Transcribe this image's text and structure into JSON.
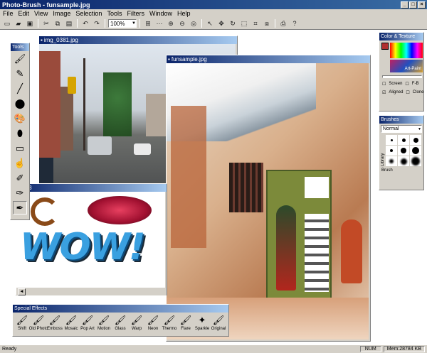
{
  "app": {
    "title": "Photo-Brush - funsample.jpg"
  },
  "menu": [
    "File",
    "Edit",
    "View",
    "Image",
    "Selection",
    "Tools",
    "Filters",
    "Window",
    "Help"
  ],
  "toolbar": {
    "zoom": "100%"
  },
  "windows": {
    "street": {
      "title": "img_0381.jpg"
    },
    "main": {
      "title": "funsample.jpg"
    },
    "wow": {
      "title": "wo8",
      "text": "WOW!"
    }
  },
  "tools_panel": {
    "title": "Tools"
  },
  "color_texture": {
    "title": "Color & Texture",
    "texture_name": "Art-Paint",
    "checks": [
      "Screen",
      "F-B",
      "Aligned",
      "Clone"
    ]
  },
  "brushes": {
    "title": "Brushes",
    "mode": "Normal",
    "side_label": "Library",
    "footer": "Brush"
  },
  "effects": {
    "title": "Special Effects",
    "items": [
      "Shift",
      "Old Photo",
      "Emboss",
      "Mosaic",
      "Pop Art",
      "Motion",
      "Glass",
      "Warp",
      "Neon",
      "Thermo",
      "Flare",
      "Sparkle",
      "Original"
    ]
  },
  "statusbar": {
    "left": "Ready",
    "num": "NUM",
    "mem": "Mem:28784 KB"
  },
  "colors": {
    "titlebar": "#0a246a",
    "face": "#d4d0c8"
  }
}
